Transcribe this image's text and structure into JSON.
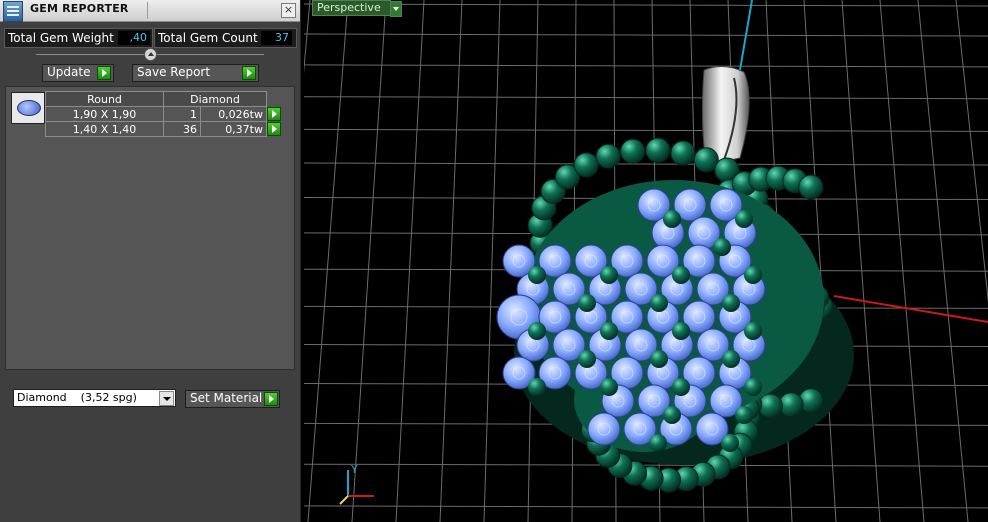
{
  "panel": {
    "title": "GEM REPORTER",
    "close_label": "×",
    "total_weight_label": "Total Gem Weight",
    "total_weight_value": ",40",
    "total_count_label": "Total Gem Count",
    "total_count_value": "37",
    "update_label": "Update",
    "save_report_label": "Save Report"
  },
  "gem_table": {
    "headers": [
      "Round",
      "Diamond"
    ],
    "rows": [
      {
        "size": "1,90 X 1,90",
        "count": "1",
        "weight": "0,026tw"
      },
      {
        "size": "1,40 X 1,40",
        "count": "36",
        "weight": "0,37tw"
      }
    ]
  },
  "material": {
    "selected": "Diamond    (3,52 spg)",
    "set_label": "Set Material"
  },
  "viewport": {
    "view_label": "Perspective",
    "axis_y": "Y"
  },
  "colors": {
    "accent_value": "#43c5e8",
    "go_button": "#2fb81a",
    "grid": "#6b6b6b",
    "metal_green": "#0f7055",
    "stone_blue": "#86a8ff"
  }
}
